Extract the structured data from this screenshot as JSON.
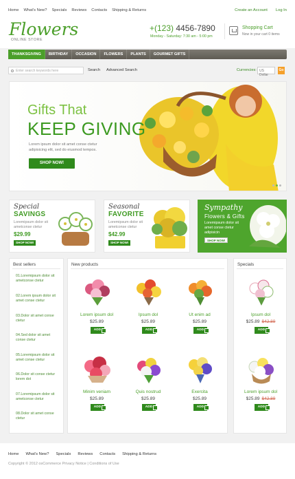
{
  "top_links": [
    "Home",
    "What's New?",
    "Specials",
    "Reviews",
    "Contacts",
    "Shipping & Returns"
  ],
  "account_links": [
    "Create an Account",
    "Log In"
  ],
  "logo": {
    "title": "Flowers",
    "subtitle": "ONLINE STORE"
  },
  "phone": {
    "prefix": "+(123)",
    "number": "4456-7890",
    "hours": "Monday - Saturday: 7:30 am - 5:00 pm"
  },
  "cart": {
    "title": "Shopping Cart",
    "status": "Now in your cart 0 items"
  },
  "nav": [
    "THANKSGIVING",
    "BIRTHDAY",
    "OCCASION",
    "FLOWERS",
    "PLANTS",
    "GOURMET GIFTS"
  ],
  "search": {
    "placeholder": "Enter search keywords here",
    "button": "Search",
    "advanced": "Advanced Search"
  },
  "currency": {
    "label": "Currencies:",
    "value": "US Dollar",
    "go": "Go"
  },
  "banner": {
    "line1": "Gifts That",
    "line2": "KEEP GIVING",
    "text": "Lorem ipsum dolor sit amet conse ctetur adipisicing elit, sed do eiusmod tempos.",
    "button": "SHOP NOW!"
  },
  "promos": [
    {
      "title1": "Special",
      "title2": "SAVINGS",
      "text": "Loremipsum dolor sit ametconse ctetur",
      "price": "$29.99",
      "button": "SHOP NOW!"
    },
    {
      "title1": "Seasonal",
      "title2": "FAVORITE",
      "text": "Loremipsum dolor sit ametconse ctetur",
      "price": "$42.99",
      "button": "SHOP NOW!"
    },
    {
      "title1": "Sympathy",
      "title2": "Flowers & Gifts",
      "text": "Loremipsum dolor sit amet conse ctetur adipisicin",
      "button": "SHOP NOW!"
    }
  ],
  "best_sellers": {
    "title": "Best sellers",
    "items": [
      "01.Loremipsum dolor sit ametconse ctetur",
      "02.Lorem ipsum dolor sit amet conse ctetur",
      "03.Dolor sit amet conse ctetur",
      "04.Sed dolor sit amet conse ctetur",
      "05.Loremipsum dolor sit amet conse ctetur",
      "06.Dolor sit conse ctetur lorem dot",
      "07.Loremipsum dolor sit ametconse ctetur",
      "08.Dolor sit amet conse ctetur"
    ]
  },
  "new_products": {
    "title": "New products",
    "items": [
      {
        "name": "Lorem ipsum dol",
        "price": "$25.89",
        "add": "ADD"
      },
      {
        "name": "Ipsum dol",
        "price": "$25.89",
        "add": "ADD"
      },
      {
        "name": "Ut enim ad",
        "price": "$25.89",
        "add": "ADD"
      },
      {
        "name": "Minim veniam",
        "price": "$25.89",
        "add": "ADD"
      },
      {
        "name": "Quis nostrud",
        "price": "$25.89",
        "add": "ADD"
      },
      {
        "name": "Exercita",
        "price": "$25.89",
        "add": "ADD"
      }
    ]
  },
  "specials": {
    "title": "Specials",
    "items": [
      {
        "name": "Ipsum dol",
        "price": "$25.89",
        "old_price": "$42.89",
        "add": "ADD"
      },
      {
        "name": "Lorem ipsum dol",
        "price": "$25.89",
        "old_price": "$42.89",
        "add": "ADD"
      }
    ]
  },
  "footer": {
    "links": [
      "Home",
      "What's New?",
      "Specials",
      "Reviews",
      "Contacts",
      "Shipping & Returns"
    ],
    "copyright": "Copyright © 2012 osCommerce    Privacy Notice  |  Conditions of Use"
  }
}
